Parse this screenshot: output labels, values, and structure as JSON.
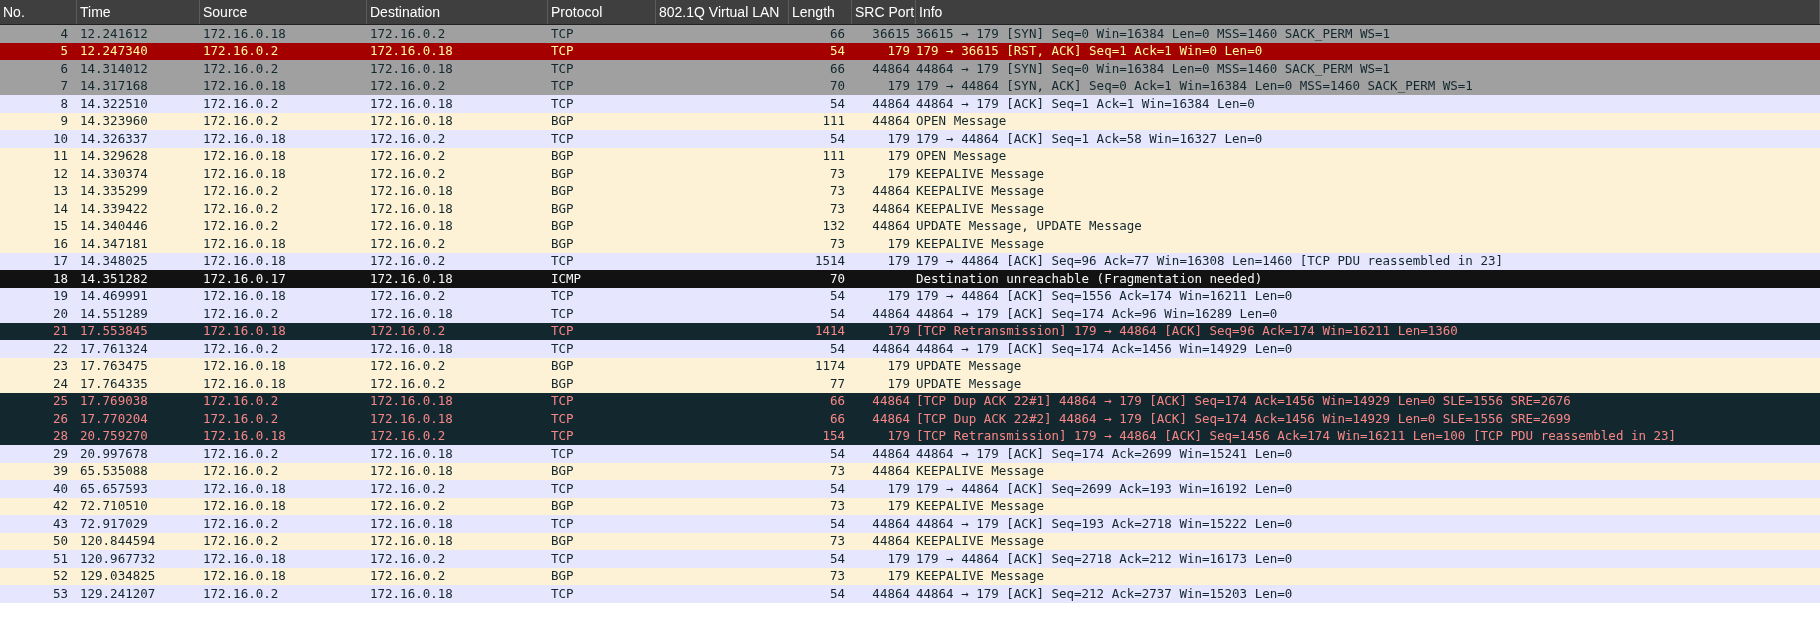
{
  "table": {
    "columns": [
      "No.",
      "Time",
      "Source",
      "Destination",
      "Protocol",
      "802.1Q Virtual LAN",
      "Length",
      "SRC Port",
      "Info"
    ],
    "rows": [
      {
        "kind": "syn",
        "no": "4",
        "time": "12.241612",
        "source": "172.16.0.18",
        "destination": "172.16.0.2",
        "protocol": "TCP",
        "length": "66",
        "src_port": "36615",
        "info": "36615 → 179 [SYN] Seq=0 Win=16384 Len=0 MSS=1460 SACK_PERM WS=1"
      },
      {
        "kind": "rst",
        "no": "5",
        "time": "12.247340",
        "source": "172.16.0.2",
        "destination": "172.16.0.18",
        "protocol": "TCP",
        "length": "54",
        "src_port": "179",
        "info": "179 → 36615 [RST, ACK] Seq=1 Ack=1 Win=0 Len=0"
      },
      {
        "kind": "syn",
        "no": "6",
        "time": "14.314012",
        "source": "172.16.0.2",
        "destination": "172.16.0.18",
        "protocol": "TCP",
        "length": "66",
        "src_port": "44864",
        "info": "44864 → 179 [SYN] Seq=0 Win=16384 Len=0 MSS=1460 SACK_PERM WS=1"
      },
      {
        "kind": "syn",
        "no": "7",
        "time": "14.317168",
        "source": "172.16.0.18",
        "destination": "172.16.0.2",
        "protocol": "TCP",
        "length": "70",
        "src_port": "179",
        "info": "179 → 44864 [SYN, ACK] Seq=0 Ack=1 Win=16384 Len=0 MSS=1460 SACK_PERM WS=1"
      },
      {
        "kind": "tcp",
        "no": "8",
        "time": "14.322510",
        "source": "172.16.0.2",
        "destination": "172.16.0.18",
        "protocol": "TCP",
        "length": "54",
        "src_port": "44864",
        "info": "44864 → 179 [ACK] Seq=1 Ack=1 Win=16384 Len=0"
      },
      {
        "kind": "bgp",
        "no": "9",
        "time": "14.323960",
        "source": "172.16.0.2",
        "destination": "172.16.0.18",
        "protocol": "BGP",
        "length": "111",
        "src_port": "44864",
        "info": "OPEN Message"
      },
      {
        "kind": "tcp",
        "no": "10",
        "time": "14.326337",
        "source": "172.16.0.18",
        "destination": "172.16.0.2",
        "protocol": "TCP",
        "length": "54",
        "src_port": "179",
        "info": "179 → 44864 [ACK] Seq=1 Ack=58 Win=16327 Len=0"
      },
      {
        "kind": "bgp",
        "no": "11",
        "time": "14.329628",
        "source": "172.16.0.18",
        "destination": "172.16.0.2",
        "protocol": "BGP",
        "length": "111",
        "src_port": "179",
        "info": "OPEN Message"
      },
      {
        "kind": "bgp",
        "no": "12",
        "time": "14.330374",
        "source": "172.16.0.18",
        "destination": "172.16.0.2",
        "protocol": "BGP",
        "length": "73",
        "src_port": "179",
        "info": "KEEPALIVE Message"
      },
      {
        "kind": "bgp",
        "no": "13",
        "time": "14.335299",
        "source": "172.16.0.2",
        "destination": "172.16.0.18",
        "protocol": "BGP",
        "length": "73",
        "src_port": "44864",
        "info": "KEEPALIVE Message"
      },
      {
        "kind": "bgp",
        "no": "14",
        "time": "14.339422",
        "source": "172.16.0.2",
        "destination": "172.16.0.18",
        "protocol": "BGP",
        "length": "73",
        "src_port": "44864",
        "info": "KEEPALIVE Message"
      },
      {
        "kind": "bgp",
        "no": "15",
        "time": "14.340446",
        "source": "172.16.0.2",
        "destination": "172.16.0.18",
        "protocol": "BGP",
        "length": "132",
        "src_port": "44864",
        "info": "UPDATE Message, UPDATE Message"
      },
      {
        "kind": "bgp",
        "no": "16",
        "time": "14.347181",
        "source": "172.16.0.18",
        "destination": "172.16.0.2",
        "protocol": "BGP",
        "length": "73",
        "src_port": "179",
        "info": "KEEPALIVE Message"
      },
      {
        "kind": "tcp",
        "no": "17",
        "time": "14.348025",
        "source": "172.16.0.18",
        "destination": "172.16.0.2",
        "protocol": "TCP",
        "length": "1514",
        "src_port": "179",
        "info": "179 → 44864 [ACK] Seq=96 Ack=77 Win=16308 Len=1460 [TCP PDU reassembled in 23]"
      },
      {
        "kind": "icmp",
        "no": "18",
        "time": "14.351282",
        "source": "172.16.0.17",
        "destination": "172.16.0.18",
        "protocol": "ICMP",
        "length": "70",
        "info": "Destination unreachable (Fragmentation needed)"
      },
      {
        "kind": "tcp",
        "no": "19",
        "time": "14.469991",
        "source": "172.16.0.18",
        "destination": "172.16.0.2",
        "protocol": "TCP",
        "length": "54",
        "src_port": "179",
        "info": "179 → 44864 [ACK] Seq=1556 Ack=174 Win=16211 Len=0"
      },
      {
        "kind": "tcp",
        "no": "20",
        "time": "14.551289",
        "source": "172.16.0.2",
        "destination": "172.16.0.18",
        "protocol": "TCP",
        "length": "54",
        "src_port": "44864",
        "info": "44864 → 179 [ACK] Seq=174 Ack=96 Win=16289 Len=0"
      },
      {
        "kind": "bad",
        "no": "21",
        "time": "17.553845",
        "source": "172.16.0.18",
        "destination": "172.16.0.2",
        "protocol": "TCP",
        "length": "1414",
        "src_port": "179",
        "info": "[TCP Retransmission] 179 → 44864 [ACK] Seq=96 Ack=174 Win=16211 Len=1360"
      },
      {
        "kind": "tcp",
        "no": "22",
        "time": "17.761324",
        "source": "172.16.0.2",
        "destination": "172.16.0.18",
        "protocol": "TCP",
        "length": "54",
        "src_port": "44864",
        "info": "44864 → 179 [ACK] Seq=174 Ack=1456 Win=14929 Len=0"
      },
      {
        "kind": "bgp",
        "no": "23",
        "time": "17.763475",
        "source": "172.16.0.18",
        "destination": "172.16.0.2",
        "protocol": "BGP",
        "length": "1174",
        "src_port": "179",
        "info": "UPDATE Message"
      },
      {
        "kind": "bgp",
        "no": "24",
        "time": "17.764335",
        "source": "172.16.0.18",
        "destination": "172.16.0.2",
        "protocol": "BGP",
        "length": "77",
        "src_port": "179",
        "info": "UPDATE Message"
      },
      {
        "kind": "bad",
        "no": "25",
        "time": "17.769038",
        "source": "172.16.0.2",
        "destination": "172.16.0.18",
        "protocol": "TCP",
        "length": "66",
        "src_port": "44864",
        "info": "[TCP Dup ACK 22#1] 44864 → 179 [ACK] Seq=174 Ack=1456 Win=14929 Len=0 SLE=1556 SRE=2676"
      },
      {
        "kind": "bad",
        "no": "26",
        "time": "17.770204",
        "source": "172.16.0.2",
        "destination": "172.16.0.18",
        "protocol": "TCP",
        "length": "66",
        "src_port": "44864",
        "info": "[TCP Dup ACK 22#2] 44864 → 179 [ACK] Seq=174 Ack=1456 Win=14929 Len=0 SLE=1556 SRE=2699"
      },
      {
        "kind": "bad",
        "no": "28",
        "time": "20.759270",
        "source": "172.16.0.18",
        "destination": "172.16.0.2",
        "protocol": "TCP",
        "length": "154",
        "src_port": "179",
        "info": "[TCP Retransmission] 179 → 44864 [ACK] Seq=1456 Ack=174 Win=16211 Len=100 [TCP PDU reassembled in 23]"
      },
      {
        "kind": "tcp",
        "no": "29",
        "time": "20.997678",
        "source": "172.16.0.2",
        "destination": "172.16.0.18",
        "protocol": "TCP",
        "length": "54",
        "src_port": "44864",
        "info": "44864 → 179 [ACK] Seq=174 Ack=2699 Win=15241 Len=0"
      },
      {
        "kind": "bgp",
        "no": "39",
        "time": "65.535088",
        "source": "172.16.0.2",
        "destination": "172.16.0.18",
        "protocol": "BGP",
        "length": "73",
        "src_port": "44864",
        "info": "KEEPALIVE Message"
      },
      {
        "kind": "tcp",
        "no": "40",
        "time": "65.657593",
        "source": "172.16.0.18",
        "destination": "172.16.0.2",
        "protocol": "TCP",
        "length": "54",
        "src_port": "179",
        "info": "179 → 44864 [ACK] Seq=2699 Ack=193 Win=16192 Len=0"
      },
      {
        "kind": "bgp",
        "no": "42",
        "time": "72.710510",
        "source": "172.16.0.18",
        "destination": "172.16.0.2",
        "protocol": "BGP",
        "length": "73",
        "src_port": "179",
        "info": "KEEPALIVE Message"
      },
      {
        "kind": "tcp",
        "no": "43",
        "time": "72.917029",
        "source": "172.16.0.2",
        "destination": "172.16.0.18",
        "protocol": "TCP",
        "length": "54",
        "src_port": "44864",
        "info": "44864 → 179 [ACK] Seq=193 Ack=2718 Win=15222 Len=0"
      },
      {
        "kind": "bgp",
        "no": "50",
        "time": "120.844594",
        "source": "172.16.0.2",
        "destination": "172.16.0.18",
        "protocol": "BGP",
        "length": "73",
        "src_port": "44864",
        "info": "KEEPALIVE Message"
      },
      {
        "kind": "tcp",
        "no": "51",
        "time": "120.967732",
        "source": "172.16.0.18",
        "destination": "172.16.0.2",
        "protocol": "TCP",
        "length": "54",
        "src_port": "179",
        "info": "179 → 44864 [ACK] Seq=2718 Ack=212 Win=16173 Len=0"
      },
      {
        "kind": "bgp",
        "no": "52",
        "time": "129.034825",
        "source": "172.16.0.18",
        "destination": "172.16.0.2",
        "protocol": "BGP",
        "length": "73",
        "src_port": "179",
        "info": "KEEPALIVE Message"
      },
      {
        "kind": "tcp",
        "no": "53",
        "time": "129.241207",
        "source": "172.16.0.2",
        "destination": "172.16.0.18",
        "protocol": "TCP",
        "length": "54",
        "src_port": "44864",
        "info": "44864 → 179 [ACK] Seq=212 Ack=2737 Win=15203 Len=0"
      }
    ]
  }
}
